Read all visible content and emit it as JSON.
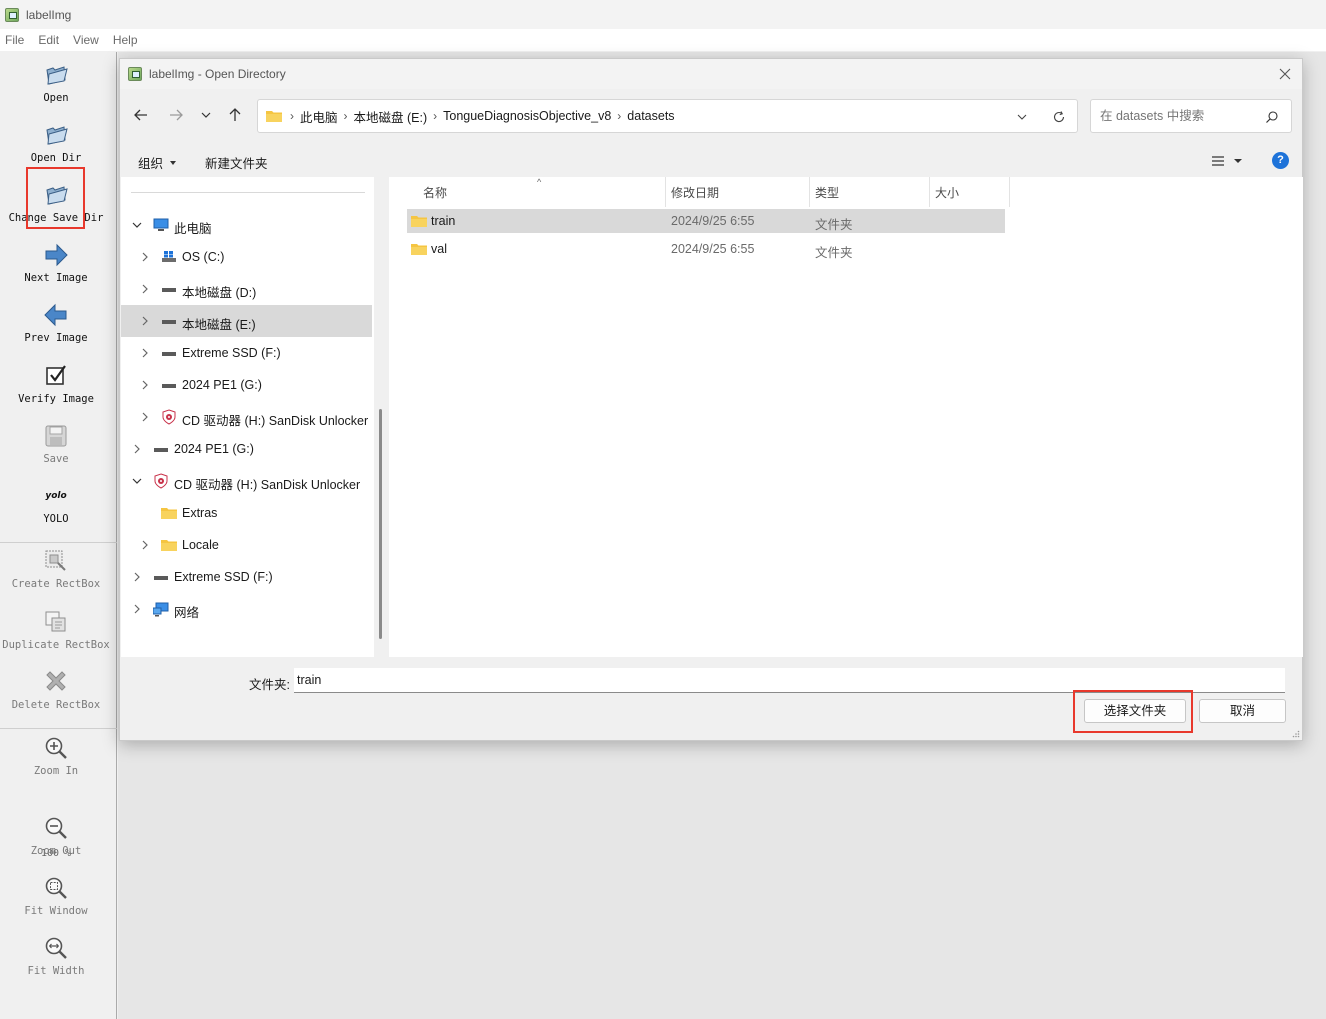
{
  "app": {
    "title": "labelImg",
    "menus": [
      "File",
      "Edit",
      "View",
      "Help"
    ]
  },
  "toolbar": {
    "items": [
      {
        "label": "Open",
        "icon": "folder-open-icon"
      },
      {
        "label": "Open Dir",
        "icon": "folder-open-icon"
      },
      {
        "label": "Change Save Dir",
        "icon": "folder-open-icon"
      },
      {
        "label": "Next Image",
        "icon": "arrow-right-icon"
      },
      {
        "label": "Prev Image",
        "icon": "arrow-left-icon"
      },
      {
        "label": "Verify Image",
        "icon": "checkbox-icon"
      },
      {
        "label": "Save",
        "icon": "floppy-disk-icon"
      },
      {
        "label": "YOLO",
        "icon": "yolo-icon",
        "icon_text": "yolo"
      },
      {
        "label": "Create RectBox",
        "icon": "create-rect-icon"
      },
      {
        "label": "Duplicate RectBox",
        "icon": "duplicate-rect-icon"
      },
      {
        "label": "Delete RectBox",
        "icon": "delete-x-icon"
      },
      {
        "label": "Zoom In",
        "icon": "zoom-in-icon"
      },
      {
        "label": "Zoom Out",
        "icon": "zoom-out-icon"
      },
      {
        "label": "Fit Window",
        "icon": "fit-window-icon"
      },
      {
        "label": "Fit Width",
        "icon": "fit-width-icon"
      }
    ],
    "zoom_value": "100 %"
  },
  "dialog": {
    "title": "labelImg - Open Directory",
    "breadcrumb": [
      "此电脑",
      "本地磁盘 (E:)",
      "TongueDiagnosisObjective_v8",
      "datasets"
    ],
    "search_placeholder": "在 datasets 中搜索",
    "commands": {
      "organize": "组织",
      "new_folder": "新建文件夹"
    },
    "help_icon_text": "?",
    "tree": [
      {
        "label": "此电脑",
        "icon": "computer-icon"
      },
      {
        "label": "OS (C:)",
        "icon": "windows-drive-icon"
      },
      {
        "label": "本地磁盘 (D:)",
        "icon": "drive-icon"
      },
      {
        "label": "本地磁盘 (E:)",
        "icon": "drive-icon"
      },
      {
        "label": "Extreme SSD (F:)",
        "icon": "drive-icon"
      },
      {
        "label": "2024 PE1 (G:)",
        "icon": "drive-icon"
      },
      {
        "label": "CD 驱动器 (H:) SanDisk Unlocker",
        "icon": "cd-drive-icon"
      },
      {
        "label": "2024 PE1 (G:)",
        "icon": "drive-icon"
      },
      {
        "label": "CD 驱动器 (H:) SanDisk Unlocker",
        "icon": "cd-drive-icon"
      },
      {
        "label": "Extras",
        "icon": "folder-icon"
      },
      {
        "label": "Locale",
        "icon": "folder-icon"
      },
      {
        "label": "Extreme SSD (F:)",
        "icon": "drive-icon"
      },
      {
        "label": "网络",
        "icon": "network-icon"
      }
    ],
    "columns": [
      "名称",
      "修改日期",
      "类型",
      "大小"
    ],
    "files": [
      {
        "name": "train",
        "modified": "2024/9/25 6:55",
        "type": "文件夹",
        "size": ""
      },
      {
        "name": "val",
        "modified": "2024/9/25 6:55",
        "type": "文件夹",
        "size": ""
      }
    ],
    "folder_label": "文件夹:",
    "folder_value": "train",
    "buttons": {
      "ok": "选择文件夹",
      "cancel": "取消"
    }
  },
  "colors": {
    "highlight": "#e8382c",
    "selection": "#d9d9d9",
    "folder": "#f5c542",
    "accent": "#1e73d9"
  }
}
